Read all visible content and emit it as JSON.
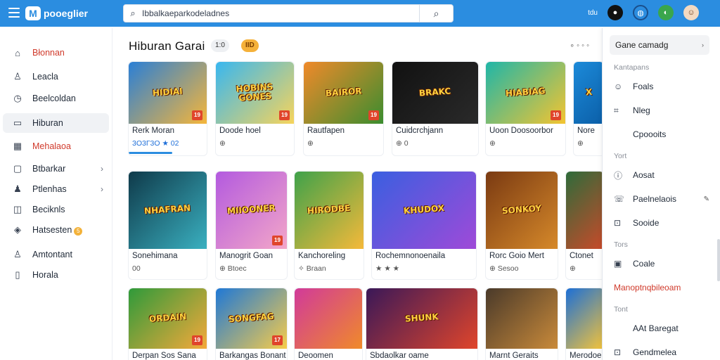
{
  "topbar": {
    "logo_text": "рooeglier",
    "search": {
      "value": "Ibbalkaeparkodeladnes"
    },
    "right_label": "tdu"
  },
  "sidebar": {
    "items": [
      {
        "label": "Błonnan",
        "icon": "home-icon",
        "style": "red"
      },
      {
        "label": "Leacla",
        "icon": "trophy-icon"
      },
      {
        "label": "Beelcoldan",
        "icon": "clock-icon"
      },
      {
        "label": "Hiburan",
        "icon": "tv-icon",
        "style": "active"
      },
      {
        "label": "Mehalaoa",
        "icon": "calendar-icon",
        "style": "red"
      },
      {
        "label": "Btbarkar",
        "icon": "box-icon",
        "chevron": true
      },
      {
        "label": "Ptlenhas",
        "icon": "people-icon",
        "chevron": true
      },
      {
        "label": "Beciknls",
        "icon": "gamepad-icon"
      },
      {
        "label": "Hatsesten",
        "icon": "shield-icon",
        "coin": "5"
      },
      {
        "label": "Amtontant",
        "icon": "user-icon"
      },
      {
        "label": "Horala",
        "icon": "book-icon"
      }
    ]
  },
  "main": {
    "title": "Hiburan Garai",
    "pill1": "1:0",
    "pill2": "IID",
    "more": "∘ ◦ ◦ ◦",
    "cards": [
      {
        "title": "Rerk Moran",
        "meta": "3O3Г3O  ★  02",
        "thumb_text": "HIDIAI",
        "age": "19",
        "colors": [
          "#2a7fd6",
          "#f6b63a"
        ],
        "meta_style": "blue",
        "progress": 0.55
      },
      {
        "title": "Doode hoel",
        "meta": "⊕",
        "thumb_text": "HOBINS GONES",
        "age": "19",
        "colors": [
          "#38b7f0",
          "#f7d45b"
        ]
      },
      {
        "title": "Rautfapen",
        "meta": "⊕",
        "thumb_text": "BAIROR",
        "age": "19",
        "colors": [
          "#f08a2a",
          "#3b8d2f"
        ]
      },
      {
        "title": "Cuidcrchjann",
        "meta": "⊕ 0",
        "thumb_text": "BRAKC",
        "age": "",
        "colors": [
          "#111111",
          "#2a2a2a"
        ]
      },
      {
        "title": "Uoon Doosoorbor",
        "meta": "⊕",
        "thumb_text": "HIABIAG",
        "age": "19",
        "colors": [
          "#1fb6a8",
          "#f4c430"
        ]
      },
      {
        "title": "Nore",
        "meta": "⊕",
        "thumb_text": "X",
        "age": "",
        "colors": [
          "#1c8ad9",
          "#0b5fa8"
        ]
      },
      {
        "title": "Sonehimana",
        "meta": "00",
        "thumb_text": "NHAFRAN",
        "age": "",
        "colors": [
          "#0f3a4a",
          "#3ab0c0"
        ]
      },
      {
        "title": "Manogrit Goan",
        "meta": "⊕  Btoec",
        "thumb_text": "MIIOONER",
        "age": "19",
        "colors": [
          "#b35adf",
          "#f3a6c8"
        ]
      },
      {
        "title": "Kanchoreling",
        "meta": "✧  Braan",
        "thumb_text": "HIRODBE",
        "age": "",
        "colors": [
          "#3fa24a",
          "#f5b93a"
        ]
      },
      {
        "title": "Rochemnonoenaila",
        "meta": "★ ★ ★",
        "thumb_text": "KHUDOX",
        "age": "",
        "colors": [
          "#3a5fe0",
          "#9f4ad8"
        ]
      },
      {
        "title": "Rorc Goio Mert",
        "meta": "⊕  Sesoo",
        "thumb_text": "SONKOY",
        "age": "",
        "colors": [
          "#7a3a12",
          "#d6892a"
        ]
      },
      {
        "title": "Ctonet",
        "meta": "⊕",
        "thumb_text": "",
        "age": "",
        "colors": [
          "#2e6b3a",
          "#c94a2a"
        ]
      },
      {
        "title": "Derpan Sos Sana",
        "meta": "",
        "thumb_text": "ORDAIN",
        "age": "19",
        "colors": [
          "#2f9a3a",
          "#f5a93a"
        ]
      },
      {
        "title": "Barkangas Bonant",
        "meta": "",
        "thumb_text": "SONGFAG",
        "age": "17",
        "colors": [
          "#1f78d6",
          "#f7cc4a"
        ]
      },
      {
        "title": "Deoomen",
        "meta": "",
        "thumb_text": "",
        "age": "",
        "colors": [
          "#d13a9a",
          "#f08a2a"
        ]
      },
      {
        "title": "Sbdaolkar oame",
        "meta": "",
        "thumb_text": "SHUNK",
        "age": "",
        "colors": [
          "#3a1858",
          "#e0452b"
        ]
      },
      {
        "title": "Marnt Geraits",
        "meta": "",
        "thumb_text": "",
        "age": "",
        "colors": [
          "#4a3a2a",
          "#c98a3a"
        ]
      },
      {
        "title": "Merodoer",
        "meta": "",
        "thumb_text": "",
        "age": "",
        "colors": [
          "#1c6fd6",
          "#f5c43a"
        ]
      }
    ]
  },
  "panel": {
    "select_label": "Gane camadg",
    "sections": [
      {
        "heading": "Kantapans",
        "items": [
          {
            "label": "Foals",
            "icon": "smile-icon"
          },
          {
            "label": "Nleg",
            "icon": "chart-icon"
          },
          {
            "label": "Cpoooits",
            "icon": ""
          }
        ]
      },
      {
        "heading": "Yort",
        "items": [
          {
            "label": "Aosat",
            "icon": "info-icon"
          },
          {
            "label": "Paelnelaois",
            "icon": "phone-icon",
            "edit": true
          },
          {
            "label": "Sooide",
            "icon": "bag-icon"
          }
        ]
      },
      {
        "heading": "Tors",
        "items": [
          {
            "label": "Coale",
            "icon": "image-icon"
          },
          {
            "label": "Manoptnqbileoam",
            "icon": "",
            "style": "red"
          }
        ]
      },
      {
        "heading": "Tont",
        "items": [
          {
            "label": "AAt Baregat",
            "icon": ""
          },
          {
            "label": "Gendmelea",
            "icon": "bag-icon"
          }
        ]
      }
    ]
  }
}
